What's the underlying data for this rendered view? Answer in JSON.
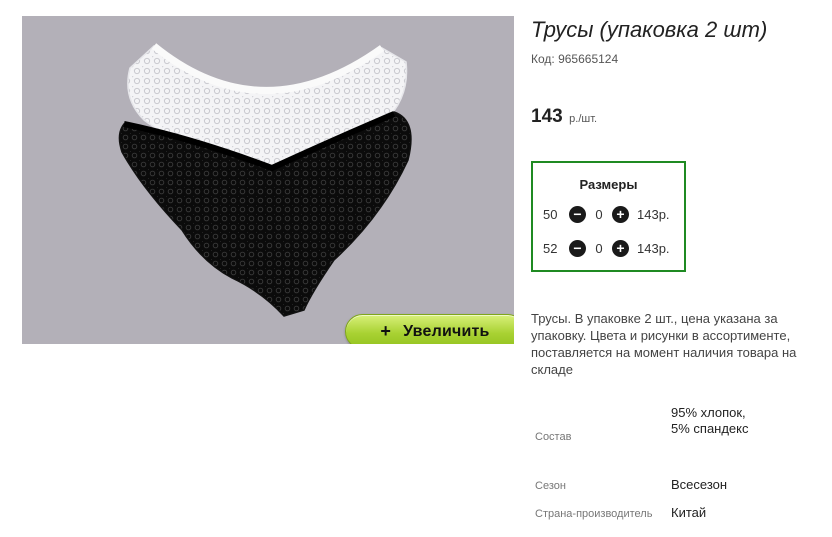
{
  "product": {
    "title": "Трусы (упаковка 2 шт)",
    "code": "Код: 965665124",
    "price": "143",
    "price_unit": "р./шт.",
    "zoom_label": "Увеличить",
    "zoom_icon": "plus-icon"
  },
  "sizes": {
    "title": "Размеры",
    "rows": [
      {
        "size": "50",
        "qty": "0",
        "price": "143р."
      },
      {
        "size": "52",
        "qty": "0",
        "price": "143р."
      }
    ]
  },
  "description": "Трусы. В упаковке 2 шт., цена указана за упаковку. Цвета и рисунки в ассортименте, поставляется на момент наличия товара на складе",
  "properties": [
    {
      "label": "Состав",
      "value": "95% хлопок, 5% спандекс"
    },
    {
      "label": "Сезон",
      "value": "Всесезон"
    },
    {
      "label": "Страна-производитель",
      "value": "Китай"
    }
  ],
  "colors": {
    "sizes_border": "#1f8a22",
    "button_green": "#a9d233",
    "photo_bg": "#b3b0b8"
  }
}
